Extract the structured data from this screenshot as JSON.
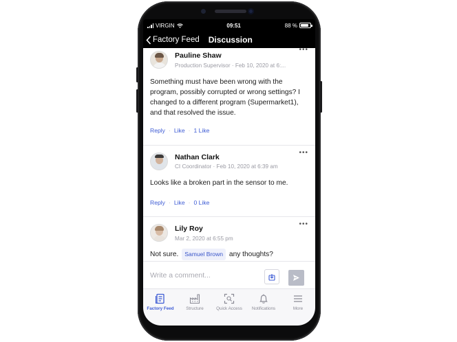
{
  "status_bar": {
    "carrier": "VIRGIN",
    "time": "09:51",
    "battery": "88 %",
    "battery_level": 0.88
  },
  "nav": {
    "back_label": "Factory Feed",
    "title": "Discussion"
  },
  "comments": [
    {
      "author": "Pauline Shaw",
      "meta": "Production Supervisor · Feb 10, 2020 at 6:...",
      "text": "Something must have been wrong with the program, possibly corrupted or wrong settings? I changed to a different program (Supermarket1), and that resolved the issue.",
      "reply": "Reply",
      "like": "Like",
      "likes": "1 Like"
    },
    {
      "author": "Nathan Clark",
      "meta": "CI Coordinator · Feb 10, 2020 at 6:39 am",
      "text": "Looks like a broken part in the sensor to me.",
      "reply": "Reply",
      "like": "Like",
      "likes": "0 Like"
    },
    {
      "author": "Lily Roy",
      "meta": "Mar 2, 2020 at 6:55 pm",
      "text_before": "Not sure.",
      "mention": "Samuel Brown",
      "text_after": "any thoughts?"
    }
  ],
  "more_label": "•••",
  "composer": {
    "placeholder": "Write a comment..."
  },
  "tabs": [
    {
      "label": "Factory Feed",
      "icon": "feed-icon",
      "active": true
    },
    {
      "label": "Structure",
      "icon": "factory-icon",
      "active": false
    },
    {
      "label": "Quick Access",
      "icon": "scan-icon",
      "active": false
    },
    {
      "label": "Notifications",
      "icon": "bell-icon",
      "active": false
    },
    {
      "label": "More",
      "icon": "menu-icon",
      "active": false
    }
  ],
  "colors": {
    "accent": "#3d5bd4",
    "nav_bg": "#000000",
    "muted": "#9a9aa3"
  }
}
